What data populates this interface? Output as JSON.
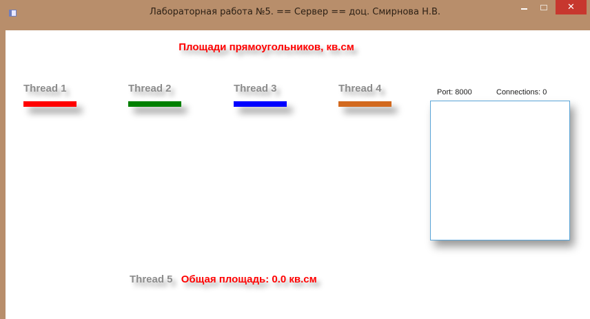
{
  "window": {
    "title": "Лабораторная работа №5. == Сервер == доц. Смирнова Н.В.",
    "controls": {
      "close_glyph": "✕"
    },
    "accent": "#b88e6b"
  },
  "main": {
    "heading": "Площади прямоугольников, кв.см",
    "threads": [
      {
        "label": "Thread 1",
        "color": "#ff0000"
      },
      {
        "label": "Thread 2",
        "color": "#008000"
      },
      {
        "label": "Thread 3",
        "color": "#0000ff"
      },
      {
        "label": "Thread 4",
        "color": "#d2691e"
      }
    ],
    "thread5_label": "Thread 5",
    "total_label": "Общая площадь: 0.0 кв.см"
  },
  "network": {
    "port_label": "Port: 8000",
    "connections_label": "Connections:  0"
  }
}
